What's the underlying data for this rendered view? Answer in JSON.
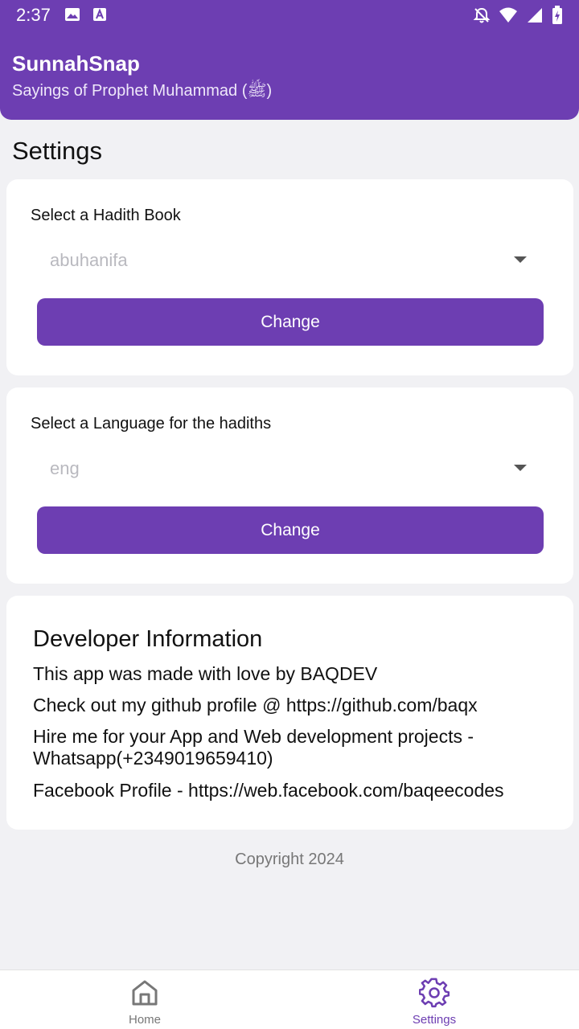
{
  "status_bar": {
    "time": "2:37",
    "left_icons": [
      "image-icon",
      "font-icon"
    ],
    "right_icons": [
      "bell-off-icon",
      "wifi-icon",
      "signal-icon",
      "battery-charging-icon"
    ]
  },
  "header": {
    "title": "SunnahSnap",
    "subtitle": "Sayings of Prophet Muhammad (ﷺ)"
  },
  "page": {
    "title": "Settings"
  },
  "book_card": {
    "label": "Select a Hadith Book",
    "selected_value": "abuhanifa",
    "button_label": "Change"
  },
  "language_card": {
    "label": "Select a Language for the hadiths",
    "selected_value": "eng",
    "button_label": "Change"
  },
  "developer_card": {
    "heading": "Developer Information",
    "lines": [
      "This app was made with love by BAQDEV",
      "Check out my github profile @ https://github.com/baqx",
      "Hire me for your App and Web development projects - Whatsapp(+2349019659410)",
      "Facebook Profile - https://web.facebook.com/baqeecodes"
    ]
  },
  "footer": {
    "copyright": "Copyright 2024"
  },
  "bottom_nav": {
    "items": [
      {
        "label": "Home",
        "icon": "home-icon",
        "active": false
      },
      {
        "label": "Settings",
        "icon": "gear-icon",
        "active": true
      }
    ]
  },
  "colors": {
    "primary": "#6d3eb2",
    "background": "#f1f1f4",
    "card": "#ffffff",
    "placeholder": "#b9b9bf"
  }
}
